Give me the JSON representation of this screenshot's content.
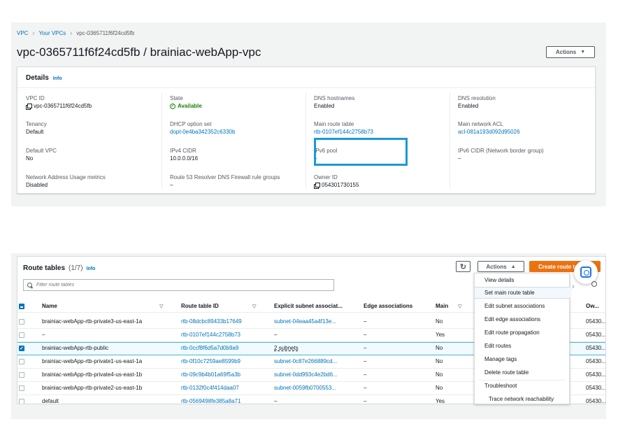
{
  "breadcrumb": {
    "vpc": "VPC",
    "your_vpcs": "Your VPCs",
    "current": "vpc-0365711f6f24cd5fb"
  },
  "page_title": "vpc-0365711f6f24cd5fb / brainiac-webApp-vpc",
  "actions_top": "Actions",
  "details": {
    "title": "Details",
    "info": "Info",
    "fields": {
      "vpc_id": {
        "label": "VPC ID",
        "value": "vpc-0365711f6f24cd5fb"
      },
      "state": {
        "label": "State",
        "value": "Available"
      },
      "dns_hostnames": {
        "label": "DNS hostnames",
        "value": "Enabled"
      },
      "dns_resolution": {
        "label": "DNS resolution",
        "value": "Enabled"
      },
      "tenancy": {
        "label": "Tenancy",
        "value": "Default"
      },
      "dhcp": {
        "label": "DHCP option set",
        "value": "dopt-0e4ba342352c6330b"
      },
      "main_rt": {
        "label": "Main route table",
        "value": "rtb-0107ef144c2758b73"
      },
      "main_acl": {
        "label": "Main network ACL",
        "value": "acl-081a193d092d95026"
      },
      "default_vpc": {
        "label": "Default VPC",
        "value": "No"
      },
      "ipv4": {
        "label": "IPv4 CIDR",
        "value": "10.0.0.0/16"
      },
      "ipv6_pool": {
        "label": "IPv6 pool",
        "value": "–"
      },
      "ipv6_cidr": {
        "label": "IPv6 CIDR (Network border group)",
        "value": "–"
      },
      "nau": {
        "label": "Network Address Usage metrics",
        "value": "Disabled"
      },
      "r53": {
        "label": "Route 53 Resolver DNS Firewall rule groups",
        "value": "–"
      },
      "owner": {
        "label": "Owner ID",
        "value": "054301730155"
      }
    }
  },
  "route_tables": {
    "title": "Route tables",
    "count": "(1/7)",
    "info": "Info",
    "actions": "Actions",
    "create": "Create route table",
    "filter_placeholder": "Filter route tables",
    "columns": [
      "Name",
      "Route table ID",
      "Explicit subnet associat...",
      "Edge associations",
      "Main",
      "Ow..."
    ],
    "rows": [
      {
        "name": "brainiac-webApp-rtb-private3-us-east-1a",
        "id": "rtb-08dcbc89433b17649",
        "subnet": "subnet-04eaa45a4f13e...",
        "edge": "–",
        "main": "No",
        "owner": "05430..."
      },
      {
        "name": "–",
        "id": "rtb-0107ef144c2758b73",
        "subnet": "–",
        "edge": "–",
        "main": "Yes",
        "owner": "05430..."
      },
      {
        "name": "brainiac-webApp-rtb-public",
        "id": "rtb-0ccf8f6d5a7d0b9a9",
        "subnet": "2 subnets",
        "edge": "–",
        "main": "No",
        "owner": "05430..."
      },
      {
        "name": "brainiac-webApp-rtb-private1-us-east-1a",
        "id": "rtb-0f10c7259ae8599b9",
        "subnet": "subnet-0c87e266889cd...",
        "edge": "–",
        "main": "No",
        "owner": "05430..."
      },
      {
        "name": "brainiac-webApp-rtb-private4-us-east-1b",
        "id": "rtb-09c9b4b01a69f5a3b",
        "subnet": "subnet-0dd993c4e2bd6...",
        "edge": "–",
        "main": "No",
        "owner": "05430..."
      },
      {
        "name": "brainiac-webApp-rtb-private2-us-east-1b",
        "id": "rtb-0132f0c4f414daa07",
        "subnet": "subnet-0059fb0700553...",
        "edge": "–",
        "main": "No",
        "owner": "05430..."
      },
      {
        "name": "default",
        "id": "rtb-0569498fe385a8a71",
        "subnet": "–",
        "edge": "–",
        "main": "Yes",
        "owner": "05430..."
      }
    ]
  },
  "dropdown": {
    "view_details": "View details",
    "set_main": "Set main route table",
    "edit_subnet": "Edit subnet associations",
    "edit_edge": "Edit edge associations",
    "edit_prop": "Edit route propagation",
    "edit_routes": "Edit routes",
    "manage_tags": "Manage tags",
    "delete": "Delete route table",
    "troubleshoot": "Troubleshoot",
    "trace": "Trace network reachability"
  },
  "colors": {
    "link": "#0073bb",
    "primary": "#ec7211",
    "success": "#1d8102",
    "highlight": "#1a9ad6"
  }
}
